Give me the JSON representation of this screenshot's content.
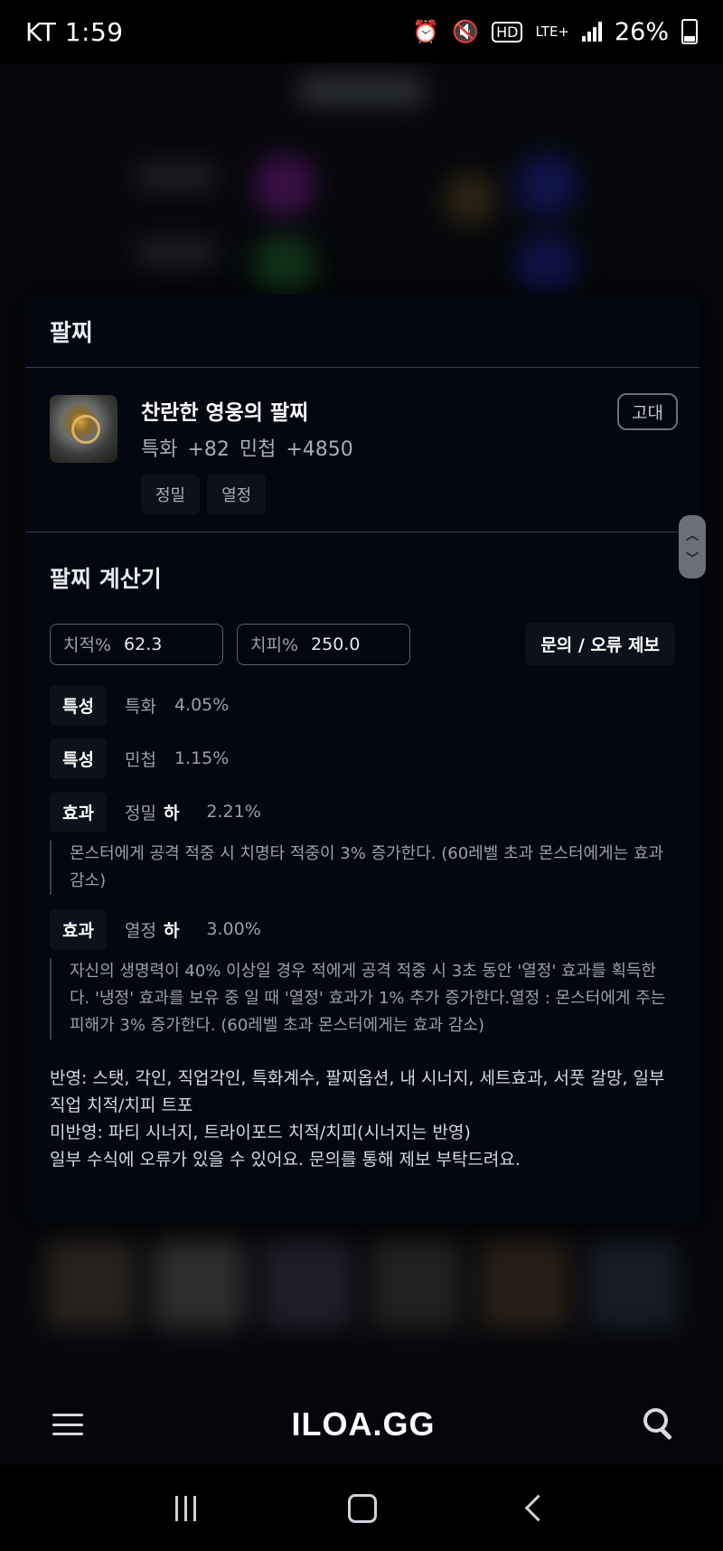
{
  "status_bar": {
    "carrier_time": "KT 1:59",
    "battery": "26%",
    "network": "LTE+",
    "hd": "HD"
  },
  "modal": {
    "title": "팔찌",
    "item": {
      "name": "찬란한 영웅의 팔찌",
      "stats": "특화 +82  민첩 +4850",
      "tags": [
        "정밀",
        "열정"
      ],
      "grade": "고대"
    },
    "calculator": {
      "title": "팔찌 계산기",
      "crit_rate": {
        "label": "치적%",
        "value": "62.3"
      },
      "crit_dmg": {
        "label": "치피%",
        "value": "250.0"
      },
      "report_button": "문의 / 오류 제보",
      "rows": [
        {
          "kind": "특성",
          "name": "특화",
          "value": "4.05%"
        },
        {
          "kind": "특성",
          "name": "민첩",
          "value": "1.15%"
        },
        {
          "kind": "효과",
          "name": "정밀",
          "grade": "하",
          "value": "2.21%",
          "desc": "몬스터에게 공격 적중 시 치명타 적중이 3% 증가한다. (60레벨 초과 몬스터에게는 효과 감소)"
        },
        {
          "kind": "효과",
          "name": "열정",
          "grade": "하",
          "value": "3.00%",
          "desc": "자신의 생명력이 40% 이상일 경우 적에게 공격 적중 시 3초 동안 '열정' 효과를 획득한다. '냉정' 효과를 보유 중 일 때 '열정' 효과가 1% 추가 증가한다.열정 : 몬스터에게 주는 피해가 3% 증가한다. (60레벨 초과 몬스터에게는 효과 감소)"
        }
      ],
      "notes": [
        "반영: 스탯, 각인, 직업각인, 특화계수, 팔찌옵션, 내 시너지, 세트효과, 서풋 갈망, 일부 직업 치적/치피 트포",
        "미반영: 파티 시너지, 트라이포드 치적/치피(시너지는 반영)",
        "일부 수식에 오류가 있을 수 있어요. 문의를 통해 제보 부탁드려요."
      ]
    }
  },
  "app_bar": {
    "logo": "ILOA.GG"
  },
  "colors": {
    "background": "#07090f",
    "modal": "#040610",
    "chip": "#0d111b",
    "muted_text": "#9aa0ab"
  }
}
